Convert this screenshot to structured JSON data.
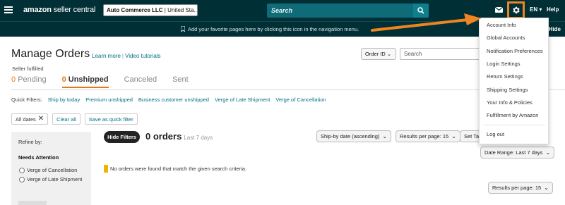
{
  "topbar": {
    "logo_bold": "amazon",
    "logo_rest": " seller central",
    "account_name": "Auto Commerce LLC",
    "account_market": " | United Sta...",
    "search_placeholder": "Search",
    "language": "EN",
    "help": "Help"
  },
  "favbar": {
    "text": "Add your favorite pages here by clicking this icon in the navigation menu.",
    "hide": "Hide"
  },
  "page": {
    "title": "Manage Orders",
    "learn_more": "Learn more",
    "video_tutorials": "Video tutorials",
    "subtitle": "Seller fulfilled",
    "order_id_select": "Order ID",
    "search_placeholder": "Search"
  },
  "tabs": [
    {
      "count": "0",
      "label": "Pending"
    },
    {
      "count": "0",
      "label": "Unshipped"
    },
    {
      "label": "Canceled"
    },
    {
      "label": "Sent"
    }
  ],
  "quick_filters": {
    "label": "Quick Filters:",
    "items": [
      "Ship by today",
      "Premium unshipped",
      "Business customer unshipped",
      "Verge of Late Shipment",
      "Verge of Cancellation"
    ]
  },
  "filter_chips": {
    "all_dates": "All dates",
    "clear_all": "Clear all",
    "save_quick": "Save as quick filter"
  },
  "sidebar": {
    "refine_by": "Refine by:",
    "needs_attention": "Needs Attention",
    "options": [
      "Verge of Cancellation",
      "Verge of Late Shipment"
    ]
  },
  "results": {
    "hide_filters": "Hide Filters",
    "orders_count": "0 orders",
    "days": "Last 7 days",
    "sort": "Ship-by date (ascending)",
    "per_page_top": "Results per page: 15",
    "set_table": "Set Ta",
    "date_range": "Date Range: Last 7 days",
    "no_orders": "No orders were found that match the given search criteria.",
    "per_page_bottom": "Results per page: 15"
  },
  "settings_menu": {
    "items": [
      "Account Info",
      "Global Accounts",
      "Notification Preferences",
      "Login Settings",
      "Return Settings",
      "Shipping Settings",
      "Your Info & Policies",
      "Fulfillment by Amazon"
    ],
    "logout": "Log out"
  },
  "colors": {
    "topbar": "#002f36",
    "accent_orange": "#f08322",
    "link": "#007185"
  }
}
